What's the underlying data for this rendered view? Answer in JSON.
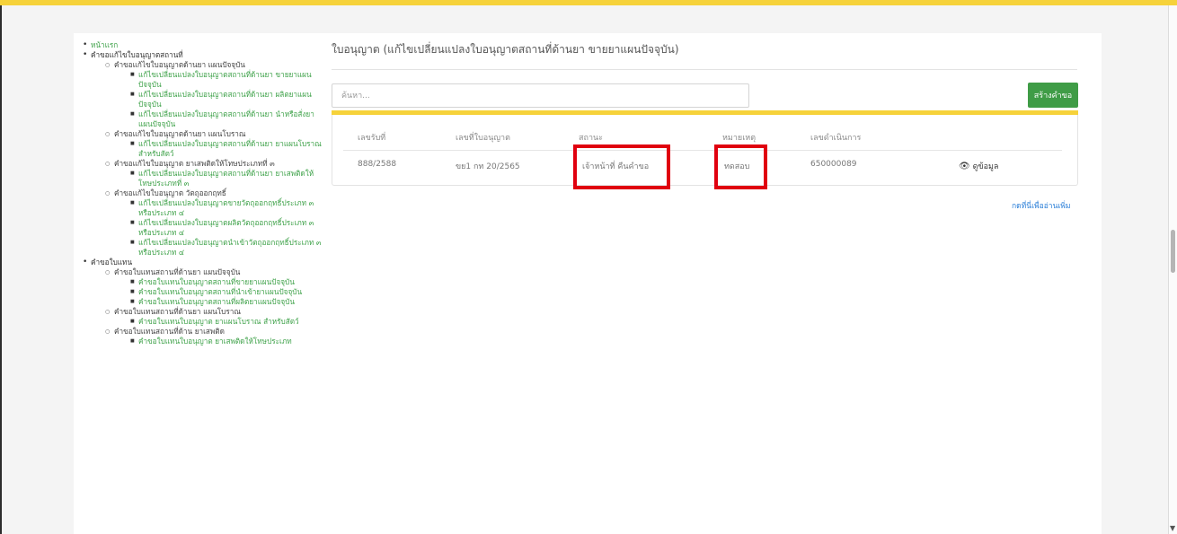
{
  "sidebar": {
    "home": "หน้าแรก",
    "groups": [
      {
        "label": "คำขอแก้ไขใบอนุญาตสถานที่",
        "subgroups": [
          {
            "label": "คำขอแก้ไขใบอนุญาตด้านยา แผนปัจจุบัน",
            "items": [
              "แก้ไขเปลี่ยนแปลงใบอนุญาตสถานที่ด้านยา ขายยาแผนปัจจุบัน",
              "แก้ไขเปลี่ยนแปลงใบอนุญาตสถานที่ด้านยา ผลิตยาแผนปัจจุบัน",
              "แก้ไขเปลี่ยนแปลงใบอนุญาตสถานที่ด้านยา นำหรือสั่งยาแผนปัจจุบัน"
            ]
          },
          {
            "label": "คำขอแก้ไขใบอนุญาตด้านยา แผนโบราณ",
            "items": [
              "แก้ไขเปลี่ยนแปลงใบอนุญาตสถานที่ด้านยา ยาแผนโบราณสำหรับสัตว์"
            ]
          },
          {
            "label": "คำขอแก้ไขใบอนุญาต ยาเสพติดให้โทษประเภทที่ ๓",
            "items": [
              "แก้ไขเปลี่ยนแปลงใบอนุญาตสถานที่ด้านยา ยาเสพติดให้โทษประเภทที่ ๓"
            ]
          },
          {
            "label": "คำขอแก้ไขใบอนุญาต วัตถุออกฤทธิ์",
            "items": [
              "แก้ไขเปลี่ยนแปลงใบอนุญาตขายวัตถุออกฤทธิ์ประเภท ๓ หรือประเภท ๔",
              "แก้ไขเปลี่ยนแปลงใบอนุญาตผลิตวัตถุออกฤทธิ์ประเภท ๓ หรือประเภท ๔",
              "แก้ไขเปลี่ยนแปลงใบอนุญาตนำเข้าวัตถุออกฤทธิ์ประเภท ๓ หรือประเภท ๔"
            ]
          }
        ]
      },
      {
        "label": "คำขอใบแทน",
        "subgroups": [
          {
            "label": "คำขอใบแทนสถานที่ด้านยา แผนปัจจุบัน",
            "items": [
              "คำขอใบแทนใบอนุญาตสถานที่ขายยาแผนปัจจุบัน",
              "คำขอใบแทนใบอนุญาตสถานที่นำเข้ายาแผนปัจจุบัน",
              "คำขอใบแทนใบอนุญาตสถานที่ผลิตยาแผนปัจจุบัน"
            ]
          },
          {
            "label": "คำขอใบแทนสถานที่ด้านยา แผนโบราณ",
            "items": [
              "คำขอใบแทนใบอนุญาต ยาแผนโบราณ สำหรับสัตว์"
            ]
          },
          {
            "label": "คำขอใบแทนสถานที่ด้าน ยาเสพติด",
            "items": [
              "คำขอใบแทนใบอนุญาต ยาเสพติดให้โทษประเภท"
            ]
          }
        ]
      }
    ]
  },
  "main": {
    "title": "ใบอนุญาต (แก้ไขเปลี่ยนแปลงใบอนุญาตสถานที่ด้านยา ขายยาแผนปัจจุบัน)",
    "search_placeholder": "ค้นหา...",
    "create_button": "สร้างคำขอ",
    "columns": [
      "เลขรับที่",
      "เลขที่ใบอนุญาต",
      "สถานะ",
      "หมายเหตุ",
      "เลขดำเนินการ"
    ],
    "rows": [
      {
        "receive_no": "888/2588",
        "license_no": "ขย1 กท 20/2565",
        "status": "เจ้าหน้าที่ คืนคำขอ",
        "remark": "ทดสอบ",
        "process_no": "650000089",
        "action": "ดูข้อมูล"
      }
    ],
    "more_link": "กดที่นี่เพื่ออ่านเพิ่ม"
  },
  "colors": {
    "accent_yellow": "#f6d23a",
    "button_green": "#3f9c46",
    "link_green": "#3fa24a",
    "highlight_red": "#e0000f",
    "link_blue": "#2b7fd8"
  },
  "icons": {
    "view": "eye-icon"
  }
}
